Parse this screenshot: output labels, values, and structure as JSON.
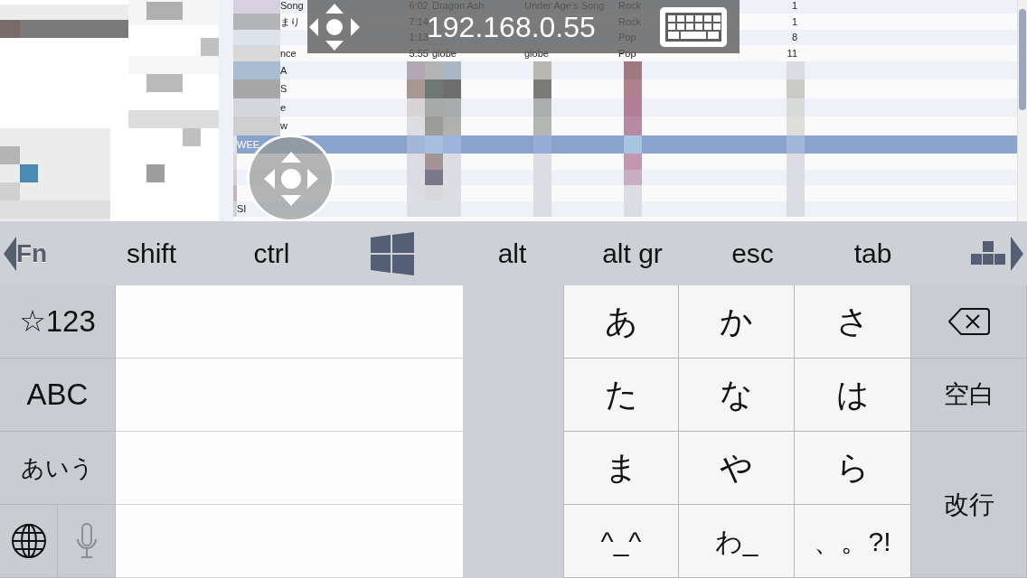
{
  "remote_desktop": {
    "rows": [
      {
        "kind": "plain",
        "title": "Song",
        "time": "6:02",
        "artist": "Dragon Ash",
        "album": "Under Age's Song",
        "genre": "Rock",
        "count": "1",
        "selected": false
      },
      {
        "kind": "plain",
        "title": "まり",
        "time": "7:14",
        "genre": "Rock",
        "count": "1",
        "selected": false
      },
      {
        "kind": "plain",
        "time": "1:13",
        "genre": "Pop",
        "count": "8",
        "selected": false
      },
      {
        "kind": "plain",
        "title": "nce",
        "time": "5:55",
        "artist": "globe",
        "album": "globe",
        "genre": "Pop",
        "count": "11",
        "selected": false
      },
      {
        "kind": "pixelated",
        "title": "A",
        "selected": false
      },
      {
        "kind": "pixelated",
        "title": "S",
        "selected": false
      },
      {
        "kind": "pixelated",
        "title": "e",
        "selected": false
      },
      {
        "kind": "pixelated",
        "title": "w",
        "selected": false
      },
      {
        "kind": "pixelated",
        "title": "WEE",
        "selected": true
      },
      {
        "kind": "pixelated",
        "selected": false
      },
      {
        "kind": "pixelated",
        "selected": false
      },
      {
        "kind": "pixelated",
        "selected": false
      },
      {
        "kind": "pixelated",
        "title": "SI",
        "selected": false
      }
    ]
  },
  "overlay_bar": {
    "address": "192.168.0.55"
  },
  "toolbar": {
    "keys": [
      {
        "kind": "fn",
        "label": "Fn"
      },
      {
        "kind": "text",
        "label": "shift"
      },
      {
        "kind": "text",
        "label": "ctrl"
      },
      {
        "kind": "windows"
      },
      {
        "kind": "text",
        "label": "alt"
      },
      {
        "kind": "text",
        "label": "alt gr"
      },
      {
        "kind": "text",
        "label": "esc"
      },
      {
        "kind": "text",
        "label": "tab"
      },
      {
        "kind": "layout"
      }
    ]
  },
  "keyboard": {
    "mode_keys": [
      "☆123",
      "ABC",
      "あいう"
    ],
    "kana_keys": [
      "あ",
      "か",
      "さ",
      "た",
      "な",
      "は",
      "ま",
      "や",
      "ら",
      "^_^",
      "わ_",
      "、。?!"
    ],
    "space_label": "空白",
    "return_label": "改行"
  }
}
